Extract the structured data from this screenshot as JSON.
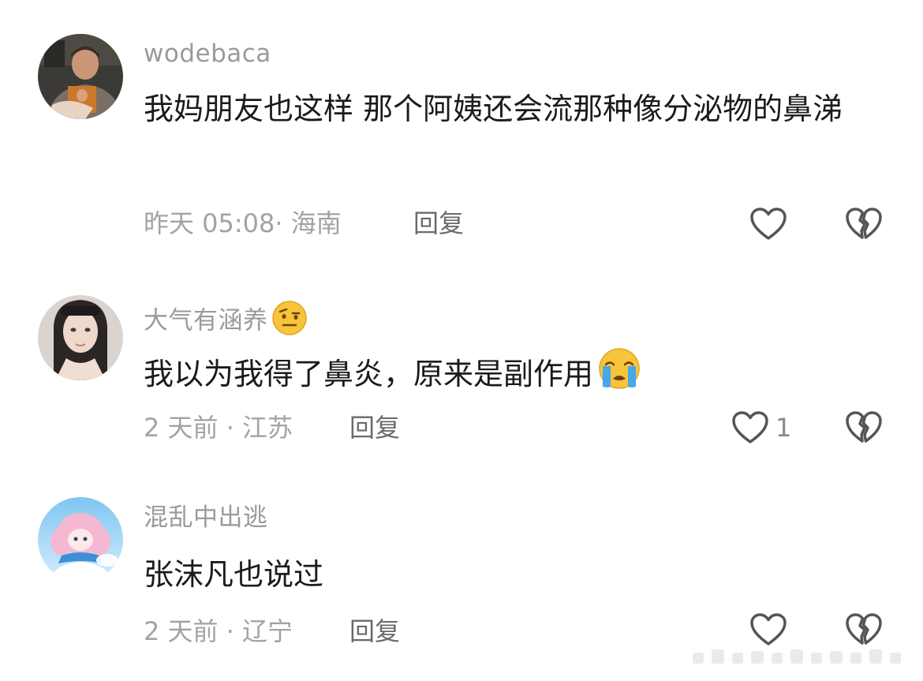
{
  "comments": [
    {
      "username": "wodebaca",
      "text": "我妈朋友也这样 那个阿姨还会流那种像分泌物的鼻涕",
      "meta": "昨天 05:08· 海南",
      "reply": "回复",
      "like_count": "",
      "avatar_icon": "person-avatar-icon"
    },
    {
      "username": "大气有涵养",
      "username_emoji": "raised-eyebrow-emoji",
      "text": "我以为我得了鼻炎，原来是副作用",
      "text_emoji": "crying-face-emoji",
      "meta": "2 天前 · 江苏",
      "reply": "回复",
      "like_count": "1",
      "avatar_icon": "person-avatar-icon"
    },
    {
      "username": "混乱中出逃",
      "text": "张沫凡也说过",
      "meta": "2 天前 · 辽宁",
      "reply": "回复",
      "like_count": "",
      "avatar_icon": "anime-avatar-icon"
    }
  ],
  "icons": {
    "like": "heart-outline-icon",
    "dislike": "broken-heart-icon"
  },
  "colors": {
    "username": "#9a9a9a",
    "text": "#1b1b1b",
    "meta": "#a3a3a3",
    "reply": "#6a6a6a",
    "icon": "#555555"
  }
}
